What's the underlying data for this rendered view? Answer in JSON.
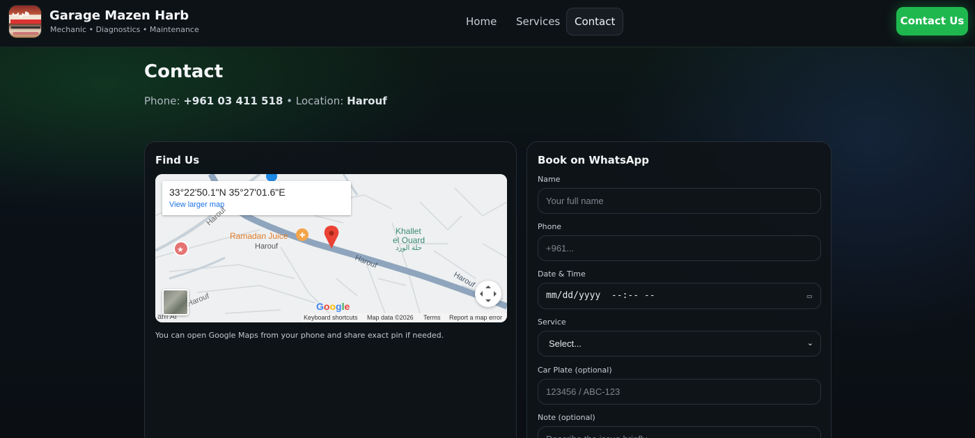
{
  "header": {
    "logo_text": "هرب",
    "brand_title": "Garage Mazen Harb",
    "brand_subtitle": "Mechanic • Diagnostics • Maintenance",
    "nav": [
      {
        "label": "Home"
      },
      {
        "label": "Services"
      },
      {
        "label": "Contact"
      }
    ],
    "active_nav": "Contact",
    "cta_label": "Contact Us"
  },
  "page": {
    "title": "Contact",
    "phone_label": "Phone:",
    "phone_value": "+961 03 411 518",
    "separator": "•",
    "location_label": "Location:",
    "location_value": "Harouf"
  },
  "find_us": {
    "title": "Find Us",
    "map": {
      "coords": "33°22'50.1\"N 35°27'01.6\"E",
      "view_larger": "View larger map",
      "poi_ramadan": "Ramadan Juice",
      "place_harouf": "Harouf",
      "place_khallet_1": "Khallet",
      "place_khallet_2": "el Ouard",
      "place_khallet_ar": "حلة الورد",
      "road_1": "Harouf",
      "road_2": "Harouf",
      "road_3": "Harouf",
      "road_4": "Harouf",
      "edge_text": "am Al",
      "google": "Google",
      "footer": {
        "shortcuts": "Keyboard shortcuts",
        "map_data": "Map data ©2026",
        "terms": "Terms",
        "report": "Report a map error"
      }
    },
    "note": "You can open Google Maps from your phone and share exact pin if needed."
  },
  "booking": {
    "title": "Book on WhatsApp",
    "name_label": "Name",
    "name_placeholder": "Your full name",
    "phone_label": "Phone",
    "phone_placeholder": "+961...",
    "datetime_label": "Date & Time",
    "datetime_value": "mm/dd/yyyy  --:-- --",
    "service_label": "Service",
    "service_value": "Select...",
    "plate_label": "Car Plate (optional)",
    "plate_placeholder": "123456 / ABC-123",
    "note_label": "Note (optional)",
    "note_placeholder": "Describe the issue briefly..."
  },
  "colors": {
    "accent_green": "#1fb84f",
    "background": "#0b1016",
    "card": "#0e1318",
    "map_pin": "#ea4335"
  }
}
